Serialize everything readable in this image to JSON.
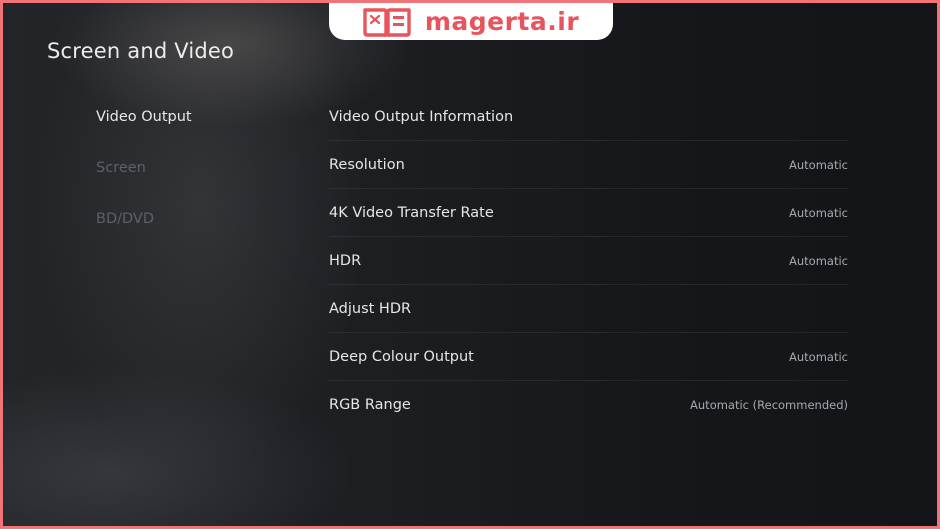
{
  "watermark": {
    "text": "magerta.ir",
    "icon": "open-book-icon",
    "color": "#e8545b"
  },
  "page": {
    "title": "Screen and Video"
  },
  "sidebar": {
    "items": [
      {
        "label": "Video Output",
        "active": true
      },
      {
        "label": "Screen",
        "active": false
      },
      {
        "label": "BD/DVD",
        "active": false
      }
    ]
  },
  "settings": {
    "rows": [
      {
        "label": "Video Output Information",
        "value": ""
      },
      {
        "label": "Resolution",
        "value": "Automatic"
      },
      {
        "label": "4K Video Transfer Rate",
        "value": "Automatic"
      },
      {
        "label": "HDR",
        "value": "Automatic"
      },
      {
        "label": "Adjust HDR",
        "value": ""
      },
      {
        "label": "Deep Colour Output",
        "value": "Automatic"
      },
      {
        "label": "RGB Range",
        "value": "Automatic (Recommended)"
      }
    ]
  },
  "colors": {
    "border": "#f07478",
    "text_primary": "#e8e8ea",
    "text_inactive": "#5d6066",
    "text_value": "#a7a9ad"
  }
}
